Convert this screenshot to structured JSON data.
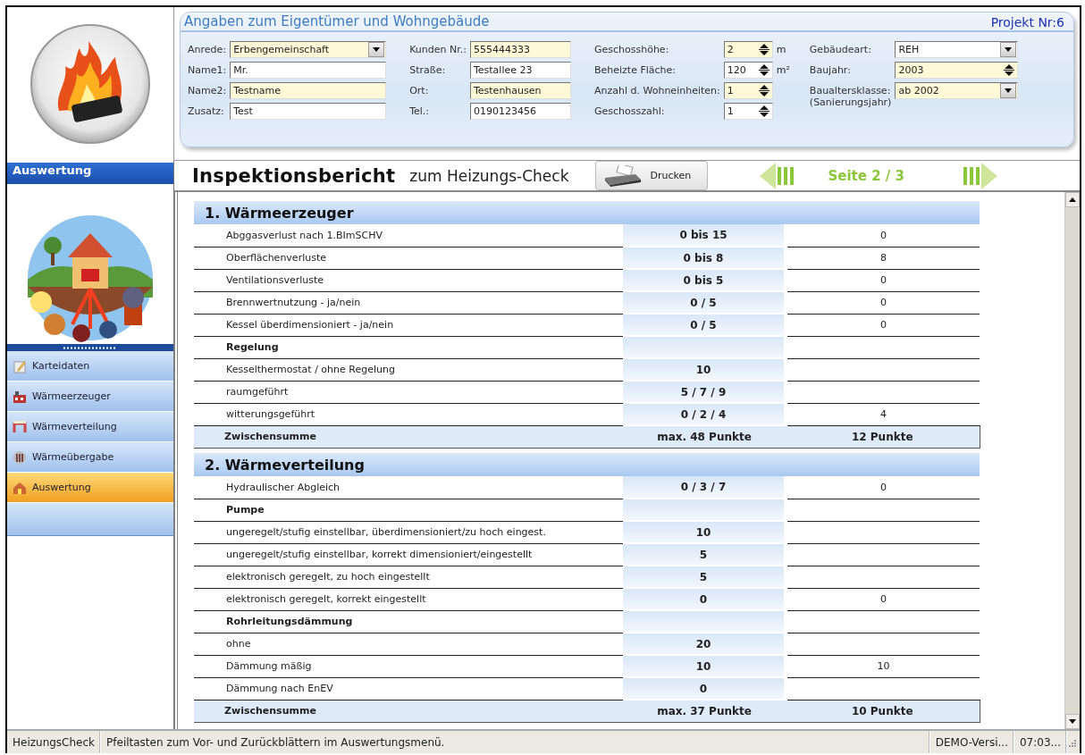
{
  "header": {
    "title": "Angaben zum Eigentümer und Wohngebäude",
    "project": "Projekt Nr:6",
    "columns": [
      [
        {
          "label": "Anrede:",
          "kind": "dropdown",
          "value": "Erbengemeinschaft",
          "highlighted": true
        },
        {
          "label": "Name1:",
          "kind": "text",
          "value": "Mr.",
          "highlighted": false
        },
        {
          "label": "Name2:",
          "kind": "text",
          "value": "Testname",
          "highlighted": true
        },
        {
          "label": "Zusatz:",
          "kind": "text",
          "value": "Test",
          "highlighted": false
        }
      ],
      [
        {
          "label": "Kunden Nr.:",
          "kind": "text",
          "value": "555444333",
          "highlighted": true
        },
        {
          "label": "Straße:",
          "kind": "text",
          "value": "Testallee 23",
          "highlighted": false
        },
        {
          "label": "Ort:",
          "kind": "text",
          "value": "Testenhausen",
          "highlighted": true
        },
        {
          "label": "Tel.:",
          "kind": "text",
          "value": "0190123456",
          "highlighted": false
        }
      ],
      [
        {
          "label": "Geschosshöhe:",
          "kind": "spinner",
          "value": "2",
          "unit": "m",
          "highlighted": true
        },
        {
          "label": "Beheizte Fläche:",
          "kind": "spinner",
          "value": "120",
          "unit": "m²",
          "highlighted": false
        },
        {
          "label": "Anzahl d. Wohneinheiten:",
          "kind": "spinner",
          "value": "1",
          "highlighted": true
        },
        {
          "label": "Geschosszahl:",
          "kind": "spinner",
          "value": "1",
          "highlighted": false
        }
      ],
      [
        {
          "label": "Gebäudeart:",
          "kind": "dropdown",
          "value": "REH",
          "highlighted": false
        },
        {
          "label": "Baujahr:",
          "kind": "spinner",
          "value": "2003",
          "highlighted": true
        },
        {
          "label": "Baualtersklasse:",
          "note": "(Sanierungsjahr)",
          "kind": "dropdown",
          "value": "ab 2002",
          "highlighted": true
        }
      ]
    ]
  },
  "sidebar": {
    "title": "Auswertung",
    "items": [
      {
        "label": "Karteidaten",
        "selected": false
      },
      {
        "label": "Wärmeerzeuger",
        "selected": false
      },
      {
        "label": "Wärmeverteilung",
        "selected": false
      },
      {
        "label": "Wärmeübergabe",
        "selected": false
      },
      {
        "label": "Auswertung",
        "selected": true
      }
    ]
  },
  "report": {
    "title": "Inspektionsbericht",
    "subtitle": "zum Heizungs-Check",
    "print_button": "Drucken",
    "page": "Seite 2 / 3",
    "sections": [
      {
        "title": "1. Wärmeerzeuger",
        "rows": [
          {
            "kind": "item",
            "label": "Abggasverlust nach 1.BImSCHV",
            "points": "0 bis 15",
            "value": "0"
          },
          {
            "kind": "item",
            "label": "Oberflächenverluste",
            "points": "0 bis 8",
            "value": "8"
          },
          {
            "kind": "item",
            "label": "Ventilationsverluste",
            "points": "0 bis 5",
            "value": "0"
          },
          {
            "kind": "item",
            "label": "Brennwertnutzung - ja/nein",
            "points": "0 / 5",
            "value": "0"
          },
          {
            "kind": "item",
            "label": "Kessel überdimensioniert - ja/nein",
            "points": "0 / 5",
            "value": "0"
          },
          {
            "kind": "group",
            "label": "Regelung"
          },
          {
            "kind": "item",
            "label": "Kesselthermostat / ohne Regelung",
            "points": "10"
          },
          {
            "kind": "item",
            "label": "raumgeführt",
            "points": "5 / 7 / 9"
          },
          {
            "kind": "item",
            "label": "witterungsgeführt",
            "points": "0 / 2 / 4",
            "value": "4"
          },
          {
            "kind": "subtotal",
            "label": "Zwischensumme",
            "points": "max. 48 Punkte",
            "value": "12 Punkte"
          }
        ]
      },
      {
        "title": "2. Wärmeverteilung",
        "rows": [
          {
            "kind": "item",
            "label": "Hydraulischer Abgleich",
            "points": "0 / 3 / 7",
            "value": "0"
          },
          {
            "kind": "group",
            "label": "Pumpe"
          },
          {
            "kind": "item",
            "label": "ungeregelt/stufig einstellbar, überdimensioniert/zu hoch eingest.",
            "points": "10"
          },
          {
            "kind": "item",
            "label": "ungeregelt/stufig einstellbar, korrekt dimensioniert/eingestellt",
            "points": "5"
          },
          {
            "kind": "item",
            "label": "elektronisch geregelt, zu hoch eingestellt",
            "points": "5"
          },
          {
            "kind": "item",
            "label": "elektronisch geregelt, korrekt eingestellt",
            "points": "0",
            "value": "0"
          },
          {
            "kind": "group",
            "label": "Rohrleitungsdämmung"
          },
          {
            "kind": "item",
            "label": "ohne",
            "points": "20"
          },
          {
            "kind": "item",
            "label": "Dämmung mäßig",
            "points": "10",
            "value": "10"
          },
          {
            "kind": "item",
            "label": "Dämmung nach EnEV",
            "points": "0"
          },
          {
            "kind": "subtotal",
            "label": "Zwischensumme",
            "points": "max. 37 Punkte",
            "value": "10 Punkte"
          }
        ]
      }
    ]
  },
  "status_bar": {
    "app": "HeizungsCheck",
    "hint": "Pfeiltasten zum Vor- und Zurückblättern im Auswertungsmenü.",
    "version": "DEMO-Versi...",
    "time": "07:03..."
  }
}
